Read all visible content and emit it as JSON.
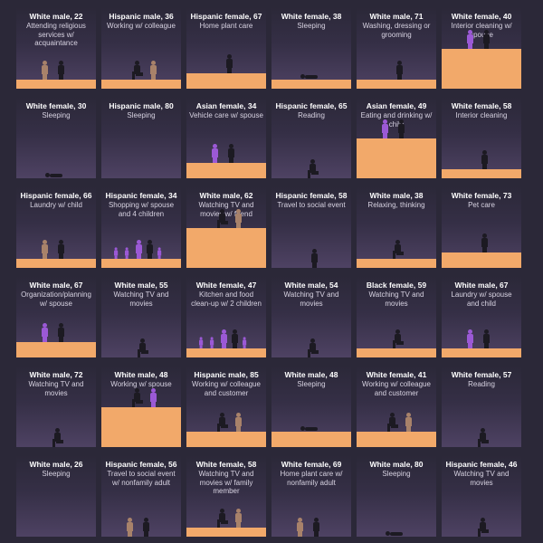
{
  "panels": [
    {
      "who": "White male, 22",
      "activity": "Attending religious services w/ acquaintance",
      "floor": "low",
      "scene": "stand-two",
      "other": "#a8826a"
    },
    {
      "who": "Hispanic male, 36",
      "activity": "Working w/ colleague",
      "floor": "low",
      "scene": "sit-two",
      "other": "#a8826a"
    },
    {
      "who": "Hispanic female, 67",
      "activity": "Home plant care",
      "floor": "mid",
      "scene": "stand"
    },
    {
      "who": "White female, 38",
      "activity": "Sleeping",
      "floor": "low",
      "scene": "lie"
    },
    {
      "who": "White male, 71",
      "activity": "Washing, dressing or grooming",
      "floor": "low",
      "scene": "stand"
    },
    {
      "who": "White female, 40",
      "activity": "Interior cleaning w/ spouse",
      "floor": "high",
      "scene": "stand-two",
      "other": "#9b59d6"
    },
    {
      "who": "White female, 30",
      "activity": "Sleeping",
      "floor": "none",
      "scene": "lie"
    },
    {
      "who": "Hispanic male, 80",
      "activity": "Sleeping",
      "floor": "none",
      "scene": "none"
    },
    {
      "who": "Asian female, 34",
      "activity": "Vehicle care w/ spouse",
      "floor": "mid",
      "scene": "stand-two",
      "other": "#9b59d6"
    },
    {
      "who": "Hispanic female, 65",
      "activity": "Reading",
      "floor": "none",
      "scene": "sit"
    },
    {
      "who": "Asian female, 49",
      "activity": "Eating and drinking w/ child",
      "floor": "high",
      "scene": "stand-two",
      "other": "#9b59d6"
    },
    {
      "who": "White female, 58",
      "activity": "Interior cleaning",
      "floor": "low",
      "scene": "stand"
    },
    {
      "who": "Hispanic female, 66",
      "activity": "Laundry w/ child",
      "floor": "low",
      "scene": "stand-two",
      "other": "#a8826a"
    },
    {
      "who": "Hispanic female, 34",
      "activity": "Shopping w/ spouse and 4 children",
      "floor": "low",
      "scene": "group",
      "other": "#9b59d6"
    },
    {
      "who": "White male, 62",
      "activity": "Watching TV and movies w/ friend",
      "floor": "high",
      "scene": "sit-two",
      "other": "#a8826a"
    },
    {
      "who": "Hispanic female, 58",
      "activity": "Travel to social event",
      "floor": "none",
      "scene": "stand"
    },
    {
      "who": "White male, 38",
      "activity": "Relaxing, thinking",
      "floor": "low",
      "scene": "sit"
    },
    {
      "who": "White female, 73",
      "activity": "Pet care",
      "floor": "mid",
      "scene": "stand"
    },
    {
      "who": "White male, 67",
      "activity": "Organization/planning w/ spouse",
      "floor": "mid",
      "scene": "stand-two",
      "other": "#9b59d6"
    },
    {
      "who": "White male, 55",
      "activity": "Watching TV and movies",
      "floor": "none",
      "scene": "sit"
    },
    {
      "who": "White female, 47",
      "activity": "Kitchen and food clean-up w/ 2 children",
      "floor": "low",
      "scene": "group",
      "other": "#9b59d6"
    },
    {
      "who": "White male, 54",
      "activity": "Watching TV and movies",
      "floor": "none",
      "scene": "sit"
    },
    {
      "who": "Black female, 59",
      "activity": "Watching TV and movies",
      "floor": "low",
      "scene": "sit"
    },
    {
      "who": "White male, 67",
      "activity": "Laundry w/ spouse and child",
      "floor": "low",
      "scene": "stand-two",
      "other": "#9b59d6"
    },
    {
      "who": "White male, 72",
      "activity": "Watching TV and movies",
      "floor": "none",
      "scene": "sit"
    },
    {
      "who": "White male, 48",
      "activity": "Working w/ spouse",
      "floor": "high",
      "scene": "sit-two",
      "other": "#9b59d6"
    },
    {
      "who": "Hispanic male, 85",
      "activity": "Working w/ colleague and customer",
      "floor": "mid",
      "scene": "sit-two",
      "other": "#a8826a"
    },
    {
      "who": "White male, 48",
      "activity": "Sleeping",
      "floor": "mid",
      "scene": "lie"
    },
    {
      "who": "White female, 41",
      "activity": "Working w/ colleague and customer",
      "floor": "mid",
      "scene": "sit-two",
      "other": "#a8826a"
    },
    {
      "who": "White female, 57",
      "activity": "Reading",
      "floor": "none",
      "scene": "sit"
    },
    {
      "who": "White male, 26",
      "activity": "Sleeping",
      "floor": "none",
      "scene": "none"
    },
    {
      "who": "Hispanic female, 56",
      "activity": "Travel to social event w/ nonfamily adult",
      "floor": "none",
      "scene": "stand-two",
      "other": "#a8826a"
    },
    {
      "who": "White female, 58",
      "activity": "Watching TV and movies w/ family member",
      "floor": "low",
      "scene": "sit-two",
      "other": "#a8826a"
    },
    {
      "who": "White female, 69",
      "activity": "Home plant care w/ nonfamily adult",
      "floor": "none",
      "scene": "stand-two",
      "other": "#a8826a"
    },
    {
      "who": "White male, 80",
      "activity": "Sleeping",
      "floor": "none",
      "scene": "lie"
    },
    {
      "who": "Hispanic female, 46",
      "activity": "Watching TV and movies",
      "floor": "none",
      "scene": "sit"
    }
  ],
  "colors": {
    "background": "#2b2838",
    "floor": "#f2a96a",
    "person": "#1c1a22",
    "family_member": "#9b59d6",
    "nonfamily_person": "#a8826a"
  }
}
